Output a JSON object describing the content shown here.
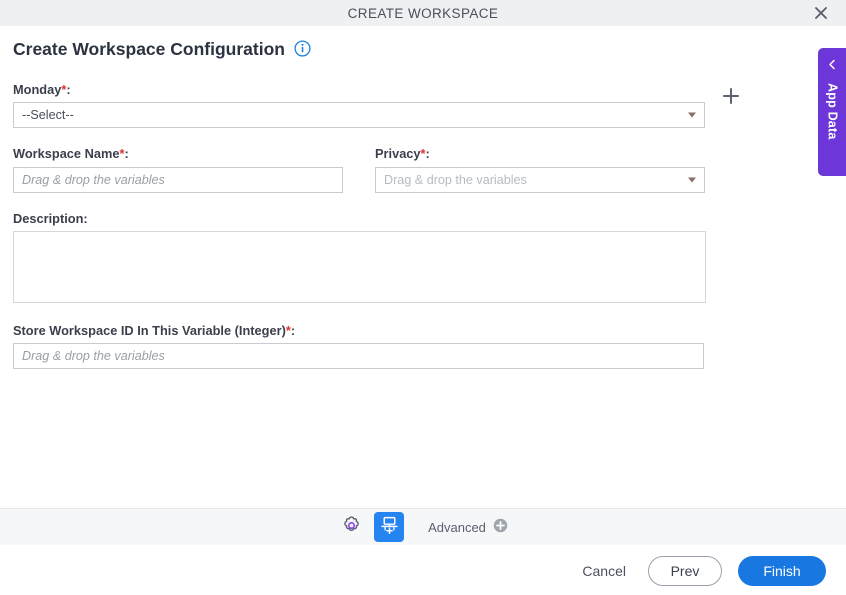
{
  "window": {
    "title": "CREATE WORKSPACE",
    "close_icon": "close-icon"
  },
  "page": {
    "heading": "Create Workspace Configuration",
    "info_icon": "info-icon"
  },
  "form": {
    "monday": {
      "label": "Monday",
      "required_mark": "*",
      "colon": ":",
      "value": "--Select--",
      "add_icon": "plus-icon"
    },
    "workspace_name": {
      "label": "Workspace Name",
      "required_mark": "*",
      "colon": ":",
      "placeholder": "Drag & drop the variables",
      "value": ""
    },
    "privacy": {
      "label": "Privacy",
      "required_mark": "*",
      "colon": ":",
      "placeholder": "Drag & drop the variables",
      "value": ""
    },
    "description": {
      "label": "Description",
      "colon": ":",
      "value": ""
    },
    "store_workspace_id": {
      "label": "Store Workspace ID In This Variable (Integer)",
      "required_mark": "*",
      "colon": ":",
      "placeholder": "Drag & drop the variables",
      "value": ""
    }
  },
  "app_data_tab": {
    "label": "App Data",
    "chevron_icon": "chevron-left-icon",
    "color": "#6c36d9"
  },
  "toolbar": {
    "settings_icon": "gear-icon",
    "workspace_icon": "workspace-add-icon",
    "advanced_label": "Advanced",
    "advanced_icon": "plus-circle-icon",
    "active_color": "#2684f0"
  },
  "buttons": {
    "cancel": "Cancel",
    "prev": "Prev",
    "finish": "Finish",
    "finish_color": "#1877e0"
  }
}
